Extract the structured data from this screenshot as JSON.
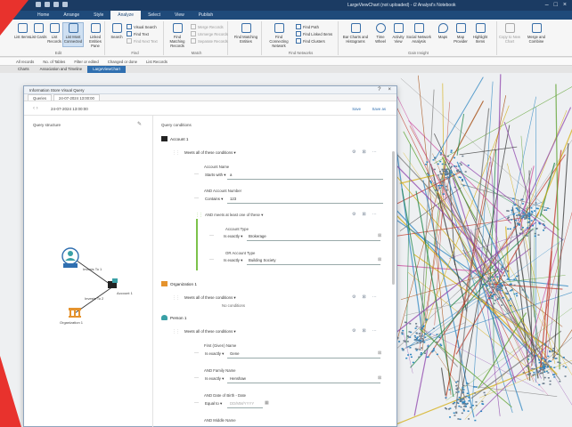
{
  "window": {
    "title": "LargeViewChart (not uploaded) - i2 Analyst's Notebook"
  },
  "ribbon_tabs": [
    "Home",
    "Arrange",
    "Style",
    "Analyze",
    "Select",
    "View",
    "Publish"
  ],
  "ribbon": {
    "groups": [
      {
        "label": "Edit",
        "buttons": [
          "List Items",
          "List Cards",
          "List Records",
          "List Most Connected",
          "Linked Entities Pane"
        ]
      },
      {
        "label": "Find",
        "buttons": [
          "Search",
          "Find Text"
        ],
        "small": [
          "Visual Search",
          "Find Text",
          "Find Next Text"
        ]
      },
      {
        "label": "Match",
        "buttons": [
          "Find Matching Records"
        ],
        "small": [
          "Merge Records",
          "Unmerge Records",
          "Separate Records"
        ]
      },
      {
        "label": "",
        "buttons": [
          "Find Matching Entities"
        ]
      },
      {
        "label": "Find Networks",
        "buttons": [
          "Find Connecting Network"
        ],
        "small": [
          "Find Path",
          "Find Linked Items",
          "Find Clusters"
        ]
      },
      {
        "label": "Gain Insight",
        "buttons": [
          "Bar Charts and Histograms",
          "Time Wheel",
          "Activity View",
          "Social Network Analysis",
          "Maps",
          "Map Provider",
          "Highlight Items"
        ]
      },
      {
        "label": "",
        "buttons": [
          "Copy to New Chart",
          "Merge and Combine"
        ]
      }
    ]
  },
  "filterbar": {
    "items": [
      "All records",
      "No. of Tables",
      "Filter or edited",
      "Changed or done",
      "List Records"
    ]
  },
  "doc_tabs": [
    "Charts",
    "Association and Timeline",
    "LargeViewChart"
  ],
  "dialog": {
    "title": "Information Store Visual Query",
    "tabs": [
      "Queries",
      "24-07-2024 13:00:00"
    ],
    "query_name": "24-07-2024 13:00:00",
    "save_label": "Save",
    "save_as_label": "Save as",
    "structure_title": "Query structure",
    "conditions_title": "Query conditions",
    "structure_nodes": [
      {
        "label": "Person 1",
        "type": "person"
      },
      {
        "label": "Invests To 1",
        "type": "link"
      },
      {
        "label": "Account 1",
        "type": "account"
      },
      {
        "label": "Invests To 2",
        "type": "link"
      },
      {
        "label": "Organization 1",
        "type": "organization"
      }
    ],
    "conditions": {
      "account": {
        "entity": "Account 1",
        "match": "Meets all of these conditions",
        "name_label": "Account Name",
        "name_op": "Starts with",
        "name_value": "a",
        "number_label": "AND Account Number",
        "number_op": "Contains",
        "number_value": "123",
        "or_group_label": "AND meets at least one of these",
        "type1_label": "Account Type",
        "type1_op": "Is exactly",
        "type1_value": "Brokerage",
        "type2_label": "OR Account Type",
        "type2_op": "Is exactly",
        "type2_value": "Building Society"
      },
      "organization": {
        "entity": "Organization 1",
        "match": "Meets all of these conditions",
        "none": "No conditions"
      },
      "person": {
        "entity": "Person 1",
        "match": "Meets all of these conditions",
        "first_label": "First (Given) Name",
        "first_op": "Is exactly",
        "first_value": "Gene",
        "family_label": "AND Family Name",
        "family_op": "Is exactly",
        "family_value": "Henshaw",
        "dob_label": "AND Date of Birth - Date",
        "dob_op": "Equal to",
        "dob_placeholder": "DD/MM/YYYY",
        "middle_label": "AND Middle Name"
      }
    }
  }
}
